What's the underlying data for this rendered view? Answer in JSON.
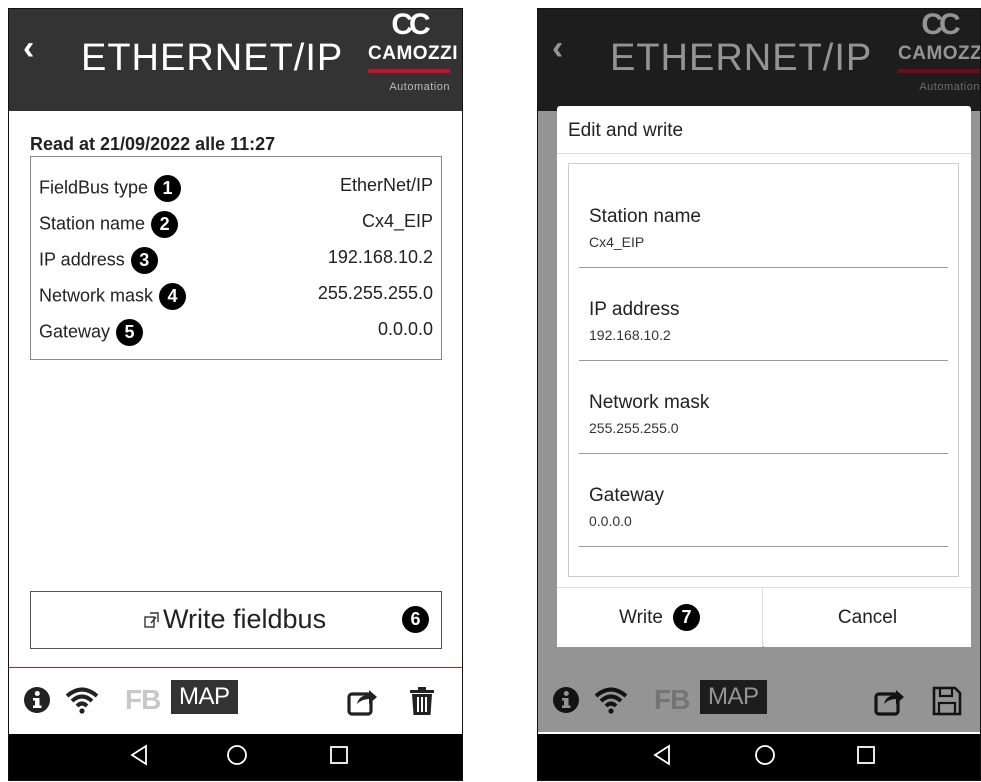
{
  "header": {
    "back": "‹",
    "title": "ETHERNET/IP",
    "brand": "CAMOZZI",
    "brand_sub": "Automation"
  },
  "left": {
    "read_at": "Read at 21/09/2022 alle 11:27",
    "fields": [
      {
        "label": "FieldBus type",
        "badge": "1",
        "value": "EtherNet/IP"
      },
      {
        "label": "Station name",
        "badge": "2",
        "value": "Cx4_EIP"
      },
      {
        "label": "IP address",
        "badge": "3",
        "value": "192.168.10.2"
      },
      {
        "label": "Network mask",
        "badge": "4",
        "value": "255.255.255.0"
      },
      {
        "label": "Gateway",
        "badge": "5",
        "value": "0.0.0.0"
      }
    ],
    "write_button": {
      "label": "Write fieldbus",
      "badge": "6"
    }
  },
  "toolbar": {
    "fb": "FB",
    "map": "MAP"
  },
  "dialog": {
    "title": "Edit and write",
    "items": [
      {
        "label": "Station name",
        "value": "Cx4_EIP"
      },
      {
        "label": "IP address",
        "value": "192.168.10.2"
      },
      {
        "label": "Network mask",
        "value": "255.255.255.0"
      },
      {
        "label": "Gateway",
        "value": "0.0.0.0"
      }
    ],
    "write_label": "Write",
    "write_badge": "7",
    "cancel_label": "Cancel"
  },
  "colors": {
    "header_bg": "#333333",
    "brand_red": "#c8102e",
    "badge_bg": "#000000"
  }
}
